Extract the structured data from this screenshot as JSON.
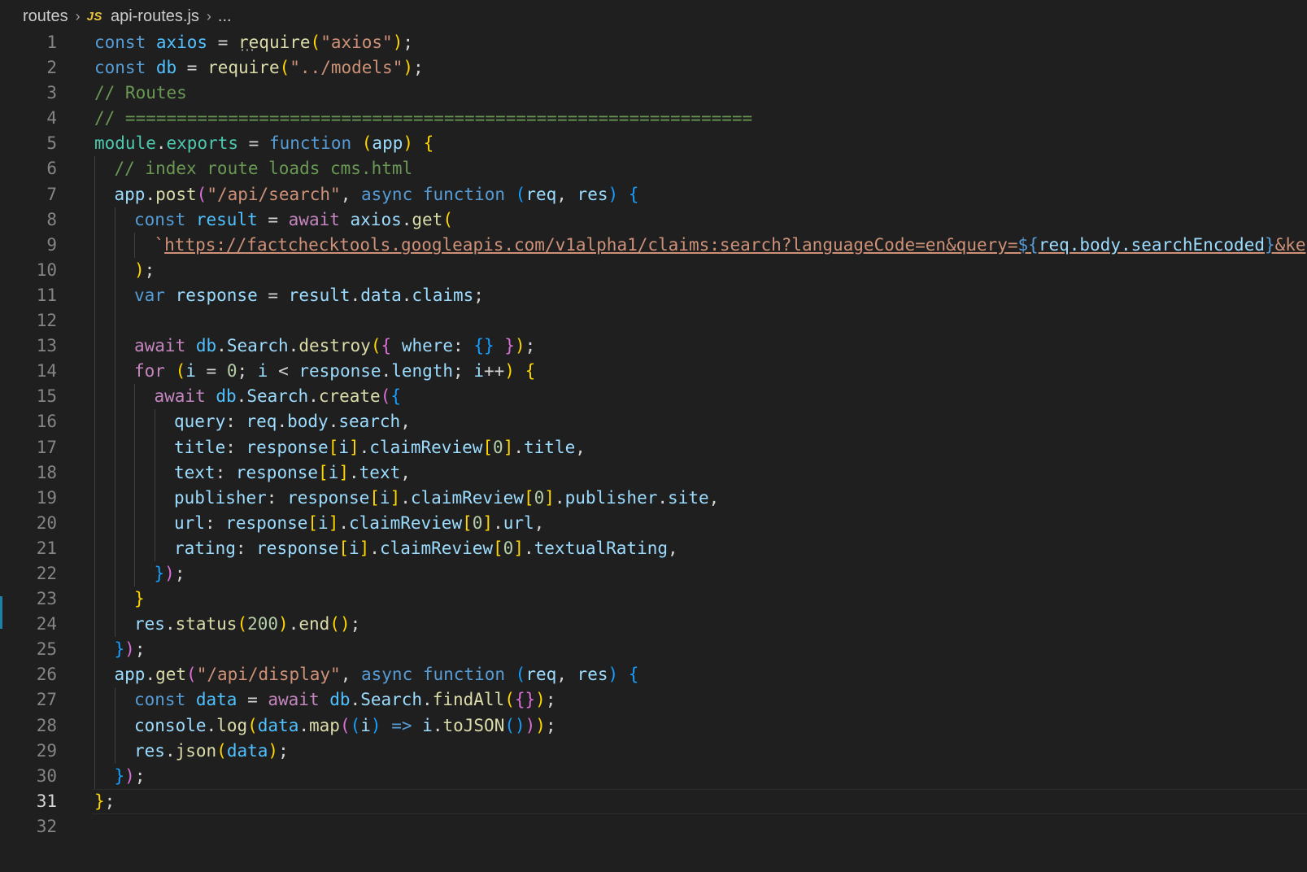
{
  "breadcrumb": {
    "folder": "routes",
    "file_badge": "JS",
    "file": "api-routes.js",
    "more": "..."
  },
  "editor": {
    "current_line": 31,
    "lines": [
      {
        "n": 1,
        "indent": 0,
        "tokens": [
          [
            "kw",
            "const "
          ],
          [
            "const",
            "axios"
          ],
          [
            "p",
            " = "
          ],
          [
            "dotted",
            "require"
          ],
          [
            "b1",
            "("
          ],
          [
            "str",
            "\"axios\""
          ],
          [
            "b1",
            ")"
          ],
          [
            "p",
            ";"
          ]
        ]
      },
      {
        "n": 2,
        "indent": 0,
        "tokens": [
          [
            "kw",
            "const "
          ],
          [
            "const",
            "db"
          ],
          [
            "p",
            " = "
          ],
          [
            "fn",
            "require"
          ],
          [
            "b1",
            "("
          ],
          [
            "str",
            "\"../models\""
          ],
          [
            "b1",
            ")"
          ],
          [
            "p",
            ";"
          ]
        ]
      },
      {
        "n": 3,
        "indent": 0,
        "tokens": [
          [
            "com",
            "// Routes"
          ]
        ]
      },
      {
        "n": 4,
        "indent": 0,
        "tokens": [
          [
            "com",
            "// ============================================================="
          ]
        ]
      },
      {
        "n": 5,
        "indent": 0,
        "tokens": [
          [
            "type",
            "module"
          ],
          [
            "p",
            "."
          ],
          [
            "type",
            "exports"
          ],
          [
            "p",
            " = "
          ],
          [
            "kw",
            "function "
          ],
          [
            "b1",
            "("
          ],
          [
            "var",
            "app"
          ],
          [
            "b1",
            ")"
          ],
          [
            "p",
            " "
          ],
          [
            "b1",
            "{"
          ]
        ]
      },
      {
        "n": 6,
        "indent": 1,
        "tokens": [
          [
            "com",
            "// index route loads cms.html"
          ]
        ]
      },
      {
        "n": 7,
        "indent": 1,
        "tokens": [
          [
            "var",
            "app"
          ],
          [
            "p",
            "."
          ],
          [
            "fn",
            "post"
          ],
          [
            "b2",
            "("
          ],
          [
            "str",
            "\"/api/search\""
          ],
          [
            "p",
            ", "
          ],
          [
            "kw",
            "async "
          ],
          [
            "kw",
            "function "
          ],
          [
            "b3",
            "("
          ],
          [
            "var",
            "req"
          ],
          [
            "p",
            ", "
          ],
          [
            "var",
            "res"
          ],
          [
            "b3",
            ")"
          ],
          [
            "p",
            " "
          ],
          [
            "b3",
            "{"
          ]
        ]
      },
      {
        "n": 8,
        "indent": 2,
        "tokens": [
          [
            "kw",
            "const "
          ],
          [
            "const",
            "result"
          ],
          [
            "p",
            " = "
          ],
          [
            "ctl",
            "await "
          ],
          [
            "var",
            "axios"
          ],
          [
            "p",
            "."
          ],
          [
            "fn",
            "get"
          ],
          [
            "b1",
            "("
          ]
        ]
      },
      {
        "n": 9,
        "indent": 3,
        "tokens": [
          [
            "str",
            "`"
          ],
          [
            "url",
            "https://factchecktools.googleapis.com/v1alpha1/claims:search?languageCode=en&query="
          ],
          [
            "tpl",
            "${"
          ],
          [
            "tplvar",
            "req.body.searchEncoded"
          ],
          [
            "tpl",
            "}"
          ],
          [
            "url",
            "&key="
          ]
        ]
      },
      {
        "n": 10,
        "indent": 2,
        "tokens": [
          [
            "b1",
            ")"
          ],
          [
            "p",
            ";"
          ]
        ]
      },
      {
        "n": 11,
        "indent": 2,
        "tokens": [
          [
            "kw",
            "var "
          ],
          [
            "var",
            "response"
          ],
          [
            "p",
            " = "
          ],
          [
            "var",
            "result"
          ],
          [
            "p",
            "."
          ],
          [
            "var",
            "data"
          ],
          [
            "p",
            "."
          ],
          [
            "var",
            "claims"
          ],
          [
            "p",
            ";"
          ]
        ]
      },
      {
        "n": 12,
        "indent": 2,
        "tokens": []
      },
      {
        "n": 13,
        "indent": 2,
        "tokens": [
          [
            "ctl",
            "await "
          ],
          [
            "const",
            "db"
          ],
          [
            "p",
            "."
          ],
          [
            "var",
            "Search"
          ],
          [
            "p",
            "."
          ],
          [
            "fn",
            "destroy"
          ],
          [
            "b1",
            "("
          ],
          [
            "b2",
            "{"
          ],
          [
            "p",
            " "
          ],
          [
            "var",
            "where"
          ],
          [
            "p",
            ": "
          ],
          [
            "b3",
            "{}"
          ],
          [
            "p",
            " "
          ],
          [
            "b2",
            "}"
          ],
          [
            "b1",
            ")"
          ],
          [
            "p",
            ";"
          ]
        ]
      },
      {
        "n": 14,
        "indent": 2,
        "tokens": [
          [
            "ctl",
            "for "
          ],
          [
            "b1",
            "("
          ],
          [
            "var",
            "i"
          ],
          [
            "p",
            " = "
          ],
          [
            "num",
            "0"
          ],
          [
            "p",
            "; "
          ],
          [
            "var",
            "i"
          ],
          [
            "p",
            " < "
          ],
          [
            "var",
            "response"
          ],
          [
            "p",
            "."
          ],
          [
            "var",
            "length"
          ],
          [
            "p",
            "; "
          ],
          [
            "var",
            "i"
          ],
          [
            "p",
            "++"
          ],
          [
            "b1",
            ")"
          ],
          [
            "p",
            " "
          ],
          [
            "b1",
            "{"
          ]
        ]
      },
      {
        "n": 15,
        "indent": 3,
        "tokens": [
          [
            "ctl",
            "await "
          ],
          [
            "const",
            "db"
          ],
          [
            "p",
            "."
          ],
          [
            "var",
            "Search"
          ],
          [
            "p",
            "."
          ],
          [
            "fn",
            "create"
          ],
          [
            "b2",
            "("
          ],
          [
            "b3",
            "{"
          ]
        ]
      },
      {
        "n": 16,
        "indent": 4,
        "tokens": [
          [
            "var",
            "query"
          ],
          [
            "p",
            ": "
          ],
          [
            "var",
            "req"
          ],
          [
            "p",
            "."
          ],
          [
            "var",
            "body"
          ],
          [
            "p",
            "."
          ],
          [
            "var",
            "search"
          ],
          [
            "p",
            ","
          ]
        ]
      },
      {
        "n": 17,
        "indent": 4,
        "tokens": [
          [
            "var",
            "title"
          ],
          [
            "p",
            ": "
          ],
          [
            "var",
            "response"
          ],
          [
            "b1",
            "["
          ],
          [
            "var",
            "i"
          ],
          [
            "b1",
            "]"
          ],
          [
            "p",
            "."
          ],
          [
            "var",
            "claimReview"
          ],
          [
            "b1",
            "["
          ],
          [
            "num",
            "0"
          ],
          [
            "b1",
            "]"
          ],
          [
            "p",
            "."
          ],
          [
            "var",
            "title"
          ],
          [
            "p",
            ","
          ]
        ]
      },
      {
        "n": 18,
        "indent": 4,
        "tokens": [
          [
            "var",
            "text"
          ],
          [
            "p",
            ": "
          ],
          [
            "var",
            "response"
          ],
          [
            "b1",
            "["
          ],
          [
            "var",
            "i"
          ],
          [
            "b1",
            "]"
          ],
          [
            "p",
            "."
          ],
          [
            "var",
            "text"
          ],
          [
            "p",
            ","
          ]
        ]
      },
      {
        "n": 19,
        "indent": 4,
        "tokens": [
          [
            "var",
            "publisher"
          ],
          [
            "p",
            ": "
          ],
          [
            "var",
            "response"
          ],
          [
            "b1",
            "["
          ],
          [
            "var",
            "i"
          ],
          [
            "b1",
            "]"
          ],
          [
            "p",
            "."
          ],
          [
            "var",
            "claimReview"
          ],
          [
            "b1",
            "["
          ],
          [
            "num",
            "0"
          ],
          [
            "b1",
            "]"
          ],
          [
            "p",
            "."
          ],
          [
            "var",
            "publisher"
          ],
          [
            "p",
            "."
          ],
          [
            "var",
            "site"
          ],
          [
            "p",
            ","
          ]
        ]
      },
      {
        "n": 20,
        "indent": 4,
        "tokens": [
          [
            "var",
            "url"
          ],
          [
            "p",
            ": "
          ],
          [
            "var",
            "response"
          ],
          [
            "b1",
            "["
          ],
          [
            "var",
            "i"
          ],
          [
            "b1",
            "]"
          ],
          [
            "p",
            "."
          ],
          [
            "var",
            "claimReview"
          ],
          [
            "b1",
            "["
          ],
          [
            "num",
            "0"
          ],
          [
            "b1",
            "]"
          ],
          [
            "p",
            "."
          ],
          [
            "var",
            "url"
          ],
          [
            "p",
            ","
          ]
        ]
      },
      {
        "n": 21,
        "indent": 4,
        "tokens": [
          [
            "var",
            "rating"
          ],
          [
            "p",
            ": "
          ],
          [
            "var",
            "response"
          ],
          [
            "b1",
            "["
          ],
          [
            "var",
            "i"
          ],
          [
            "b1",
            "]"
          ],
          [
            "p",
            "."
          ],
          [
            "var",
            "claimReview"
          ],
          [
            "b1",
            "["
          ],
          [
            "num",
            "0"
          ],
          [
            "b1",
            "]"
          ],
          [
            "p",
            "."
          ],
          [
            "var",
            "textualRating"
          ],
          [
            "p",
            ","
          ]
        ]
      },
      {
        "n": 22,
        "indent": 3,
        "tokens": [
          [
            "b3",
            "}"
          ],
          [
            "b2",
            ")"
          ],
          [
            "p",
            ";"
          ]
        ]
      },
      {
        "n": 23,
        "indent": 2,
        "tokens": [
          [
            "b1",
            "}"
          ]
        ]
      },
      {
        "n": 24,
        "indent": 2,
        "tokens": [
          [
            "var",
            "res"
          ],
          [
            "p",
            "."
          ],
          [
            "fn",
            "status"
          ],
          [
            "b1",
            "("
          ],
          [
            "num",
            "200"
          ],
          [
            "b1",
            ")"
          ],
          [
            "p",
            "."
          ],
          [
            "fn",
            "end"
          ],
          [
            "b1",
            "()"
          ],
          [
            "p",
            ";"
          ]
        ]
      },
      {
        "n": 25,
        "indent": 1,
        "tokens": [
          [
            "b3",
            "}"
          ],
          [
            "b2",
            ")"
          ],
          [
            "p",
            ";"
          ]
        ]
      },
      {
        "n": 26,
        "indent": 1,
        "tokens": [
          [
            "var",
            "app"
          ],
          [
            "p",
            "."
          ],
          [
            "fn",
            "get"
          ],
          [
            "b2",
            "("
          ],
          [
            "str",
            "\"/api/display\""
          ],
          [
            "p",
            ", "
          ],
          [
            "kw",
            "async "
          ],
          [
            "kw",
            "function "
          ],
          [
            "b3",
            "("
          ],
          [
            "var",
            "req"
          ],
          [
            "p",
            ", "
          ],
          [
            "var",
            "res"
          ],
          [
            "b3",
            ")"
          ],
          [
            "p",
            " "
          ],
          [
            "b3",
            "{"
          ]
        ]
      },
      {
        "n": 27,
        "indent": 2,
        "tokens": [
          [
            "kw",
            "const "
          ],
          [
            "const",
            "data"
          ],
          [
            "p",
            " = "
          ],
          [
            "ctl",
            "await "
          ],
          [
            "const",
            "db"
          ],
          [
            "p",
            "."
          ],
          [
            "var",
            "Search"
          ],
          [
            "p",
            "."
          ],
          [
            "fn",
            "findAll"
          ],
          [
            "b1",
            "("
          ],
          [
            "b2",
            "{}"
          ],
          [
            "b1",
            ")"
          ],
          [
            "p",
            ";"
          ]
        ]
      },
      {
        "n": 28,
        "indent": 2,
        "tokens": [
          [
            "var",
            "console"
          ],
          [
            "p",
            "."
          ],
          [
            "fn",
            "log"
          ],
          [
            "b1",
            "("
          ],
          [
            "const",
            "data"
          ],
          [
            "p",
            "."
          ],
          [
            "fn",
            "map"
          ],
          [
            "b2",
            "("
          ],
          [
            "b3",
            "("
          ],
          [
            "var",
            "i"
          ],
          [
            "b3",
            ")"
          ],
          [
            "p",
            " "
          ],
          [
            "kw",
            "=>"
          ],
          [
            "p",
            " "
          ],
          [
            "var",
            "i"
          ],
          [
            "p",
            "."
          ],
          [
            "fn",
            "toJSON"
          ],
          [
            "b3",
            "()"
          ],
          [
            "b2",
            ")"
          ],
          [
            "b1",
            ")"
          ],
          [
            "p",
            ";"
          ]
        ]
      },
      {
        "n": 29,
        "indent": 2,
        "tokens": [
          [
            "var",
            "res"
          ],
          [
            "p",
            "."
          ],
          [
            "fn",
            "json"
          ],
          [
            "b1",
            "("
          ],
          [
            "const",
            "data"
          ],
          [
            "b1",
            ")"
          ],
          [
            "p",
            ";"
          ]
        ]
      },
      {
        "n": 30,
        "indent": 1,
        "tokens": [
          [
            "b3",
            "}"
          ],
          [
            "b2",
            ")"
          ],
          [
            "p",
            ";"
          ]
        ]
      },
      {
        "n": 31,
        "indent": 0,
        "tokens": [
          [
            "b1",
            "}"
          ],
          [
            "p",
            ";"
          ]
        ]
      },
      {
        "n": 32,
        "indent": 0,
        "tokens": []
      }
    ]
  }
}
